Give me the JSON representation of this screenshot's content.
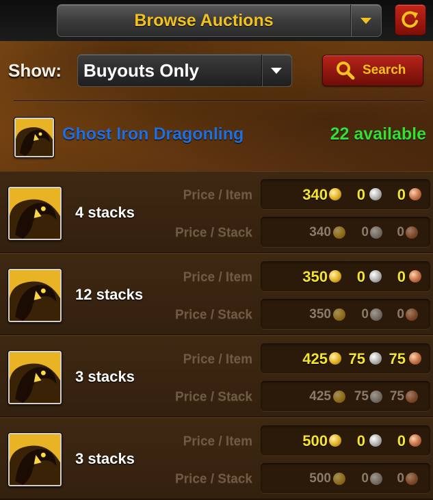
{
  "header": {
    "title": "Browse Auctions",
    "title_dropdown_icon": "chevron-down-icon",
    "refresh_icon": "refresh-icon"
  },
  "filter": {
    "show_label": "Show:",
    "show_value": "Buyouts Only",
    "search_label": "Search",
    "search_icon": "magnifier-icon"
  },
  "item": {
    "name": "Ghost Iron Dragonling",
    "available": "22 available"
  },
  "labels": {
    "price_item": "Price / Item",
    "price_stack": "Price / Stack"
  },
  "listings": [
    {
      "stacks": "4 stacks",
      "item": {
        "gold": "340",
        "silver": "0",
        "copper": "0"
      },
      "stack": {
        "gold": "340",
        "silver": "0",
        "copper": "0"
      }
    },
    {
      "stacks": "12 stacks",
      "item": {
        "gold": "350",
        "silver": "0",
        "copper": "0"
      },
      "stack": {
        "gold": "350",
        "silver": "0",
        "copper": "0"
      }
    },
    {
      "stacks": "3 stacks",
      "item": {
        "gold": "425",
        "silver": "75",
        "copper": "75"
      },
      "stack": {
        "gold": "425",
        "silver": "75",
        "copper": "75"
      }
    },
    {
      "stacks": "3 stacks",
      "item": {
        "gold": "500",
        "silver": "0",
        "copper": "0"
      },
      "stack": {
        "gold": "500",
        "silver": "0",
        "copper": "0"
      }
    }
  ],
  "colors": {
    "accent_gold": "#f2c21e",
    "item_name": "#1f6fe0",
    "available": "#35e030",
    "price_item": "#f4e52c"
  }
}
